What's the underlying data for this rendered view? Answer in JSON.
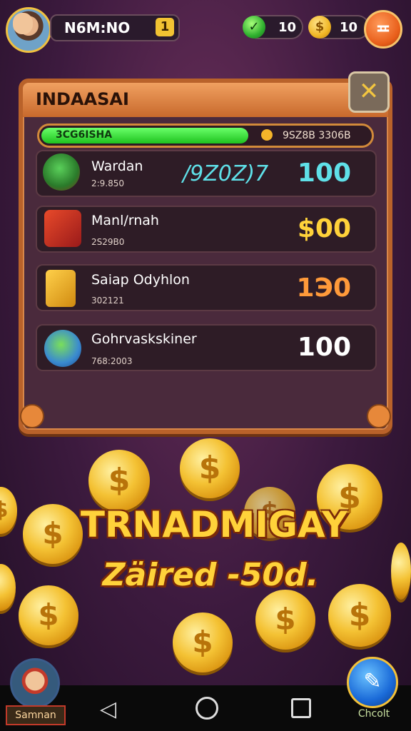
{
  "header": {
    "player_name": "N6M:NO",
    "level": "1",
    "gems": "10",
    "coins": "10",
    "menu_icon": "angry-face-icon"
  },
  "panel": {
    "title": "INDAASAI",
    "close_icon": "crossed-swords-icon",
    "progress": {
      "label": "3CG6ISHA",
      "value_text": "9SZ8B 3306B",
      "fraction": 0.63
    }
  },
  "rows": [
    {
      "name": "Wardan",
      "sub": "2:9.850",
      "extra": "/9Z0Z)7",
      "value": "100",
      "value_color": "#5fe0e8",
      "icon": "green-turtle-icon"
    },
    {
      "name": "Manl/rnah",
      "sub": "2S29B0",
      "extra": "",
      "value": "$00",
      "value_color": "#ffd23a",
      "icon": "red-shield-icon"
    },
    {
      "name": "Saiap Odyhlon",
      "sub": "302121",
      "extra": "",
      "value": "1Э0",
      "value_color": "#ff9a3a",
      "icon": "banner-flag-icon"
    },
    {
      "name": "Gohrvaskskiner",
      "sub": "768:2003",
      "extra": "",
      "value": "100",
      "value_color": "#ffffff",
      "icon": "salad-bowl-icon"
    }
  ],
  "promo": {
    "title": "TRNADMIGAY",
    "subtitle": "Zäired -50d."
  },
  "bottom": {
    "avatar_label": "Samnan",
    "action_label": "Chcolt",
    "action_icon": "flashlight-icon"
  },
  "coin_symbol": "$"
}
